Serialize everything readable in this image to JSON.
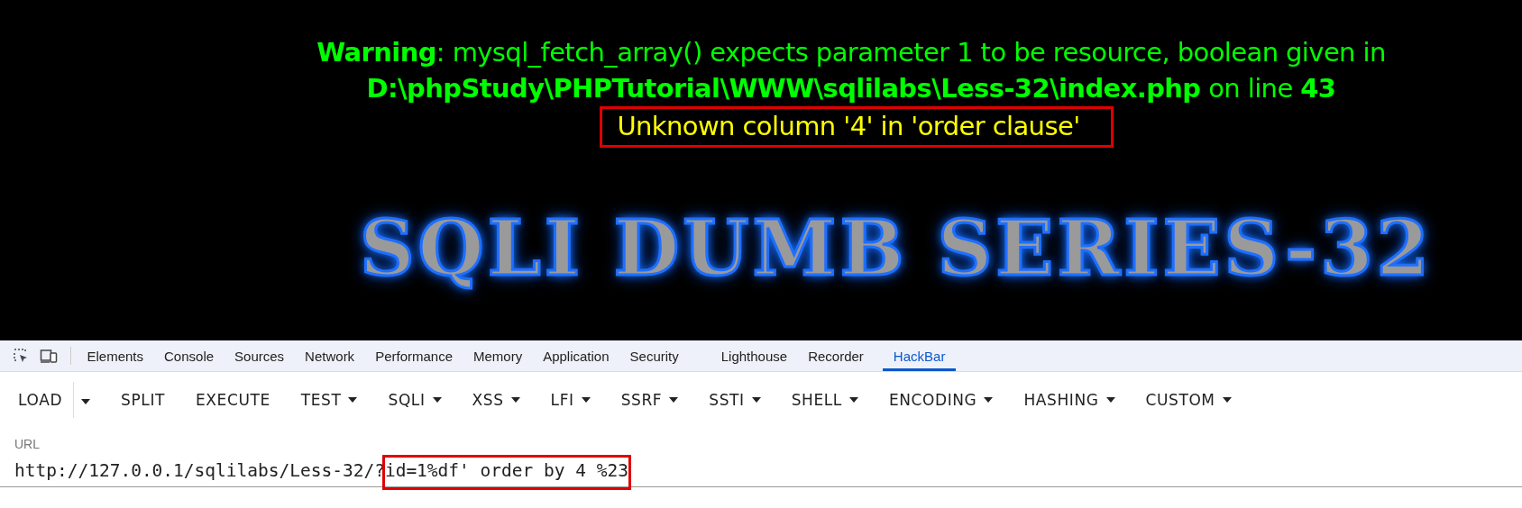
{
  "page": {
    "warning_lines": [
      "**Warning**: mysql_fetch_array() expects parameter 1 to be resource, boolean given in",
      "**D:\\phpStudy\\PHPTutorial\\WWW\\sqlilabs\\Less-32\\index.php** on line **43**"
    ],
    "error_message": "Unknown column '4' in 'order clause'",
    "logo": "SQLI DUMB SERIES-32"
  },
  "devtools": {
    "tabs": [
      {
        "label": "Elements",
        "selected": false
      },
      {
        "label": "Console",
        "selected": false
      },
      {
        "label": "Sources",
        "selected": false
      },
      {
        "label": "Network",
        "selected": false
      },
      {
        "label": "Performance",
        "selected": false
      },
      {
        "label": "Memory",
        "selected": false
      },
      {
        "label": "Application",
        "selected": false
      },
      {
        "label": "Security",
        "selected": false
      },
      {
        "label": "Lighthouse",
        "selected": false
      },
      {
        "label": "Recorder",
        "selected": false
      },
      {
        "label": "HackBar",
        "selected": true
      }
    ]
  },
  "hackbar": {
    "buttons": [
      {
        "label": "LOAD",
        "kind": "split"
      },
      {
        "label": "SPLIT",
        "kind": "plain"
      },
      {
        "label": "EXECUTE",
        "kind": "plain"
      },
      {
        "label": "TEST",
        "kind": "menu"
      },
      {
        "label": "SQLI",
        "kind": "menu"
      },
      {
        "label": "XSS",
        "kind": "menu"
      },
      {
        "label": "LFI",
        "kind": "menu"
      },
      {
        "label": "SSRF",
        "kind": "menu"
      },
      {
        "label": "SSTI",
        "kind": "menu"
      },
      {
        "label": "SHELL",
        "kind": "menu"
      },
      {
        "label": "ENCODING",
        "kind": "menu"
      },
      {
        "label": "HASHING",
        "kind": "menu"
      },
      {
        "label": "CUSTOM",
        "kind": "menu"
      }
    ],
    "url": {
      "label": "URL",
      "value": "http://127.0.0.1/sqlilabs/Less-32/?id=1%df' order by 4 %23"
    }
  }
}
